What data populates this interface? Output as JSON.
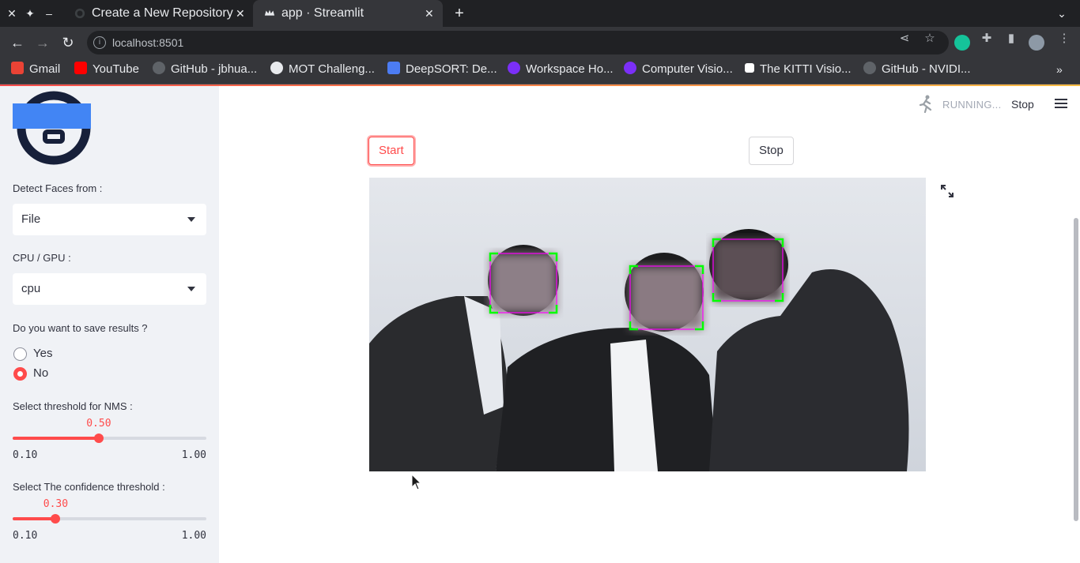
{
  "browser": {
    "tabs": [
      {
        "title": "Create a New Repository"
      },
      {
        "title": "app · Streamlit"
      }
    ],
    "url": "localhost:8501",
    "bookmarks": [
      {
        "label": "Gmail",
        "color": "#ea4335"
      },
      {
        "label": "YouTube",
        "color": "#ff0000"
      },
      {
        "label": "GitHub - jbhua...",
        "color": "#5f6368"
      },
      {
        "label": "MOT Challeng...",
        "color": "#e8eaed"
      },
      {
        "label": "DeepSORT: De...",
        "color": "#4c7cf3"
      },
      {
        "label": "Workspace Ho...",
        "color": "#7b2ff7"
      },
      {
        "label": "Computer Visio...",
        "color": "#7b2ff7"
      },
      {
        "label": "The KITTI Visio...",
        "color": "#ffffff"
      },
      {
        "label": "GitHub - NVIDI...",
        "color": "#5f6368"
      }
    ]
  },
  "sidebar": {
    "detect_label": "Detect Faces from :",
    "detect_value": "File",
    "device_label": "CPU / GPU :",
    "device_value": "cpu",
    "save_label": "Do you want to save results ?",
    "save_options": [
      "Yes",
      "No"
    ],
    "save_selected": "No",
    "nms": {
      "label": "Select threshold for NMS :",
      "value": "0.50",
      "min": "0.10",
      "max": "1.00",
      "num_value": 0.5,
      "num_min": 0.1,
      "num_max": 1.0
    },
    "conf": {
      "label": "Select The confidence threshold :",
      "value": "0.30",
      "min": "0.10",
      "max": "1.00",
      "num_value": 0.3,
      "num_min": 0.1,
      "num_max": 1.0
    }
  },
  "header": {
    "status": "RUNNING...",
    "stop_label": "Stop"
  },
  "main": {
    "start_label": "Start",
    "stop_label": "Stop"
  },
  "colors": {
    "accent": "#ff4b4b",
    "sidebar_bg": "#f0f2f6",
    "detect_box": "#00ff00",
    "face_outline": "#ff00ff"
  }
}
